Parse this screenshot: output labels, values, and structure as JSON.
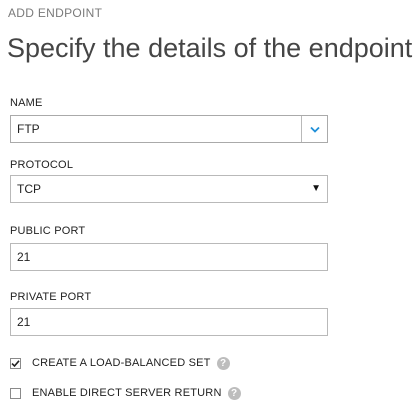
{
  "header": {
    "kicker": "ADD ENDPOINT",
    "title": "Specify the details of the endpoint"
  },
  "form": {
    "name": {
      "label": "NAME",
      "value": "FTP"
    },
    "protocol": {
      "label": "PROTOCOL",
      "value": "TCP",
      "arrow": "▼"
    },
    "public_port": {
      "label": "PUBLIC PORT",
      "value": "21"
    },
    "private_port": {
      "label": "PRIVATE PORT",
      "value": "21"
    },
    "load_balanced": {
      "label": "CREATE A LOAD-BALANCED SET",
      "checked": true,
      "help": "?"
    },
    "direct_server_return": {
      "label": "ENABLE DIRECT SERVER RETURN",
      "checked": false,
      "help": "?"
    }
  },
  "colors": {
    "accent": "#1f8fd8",
    "border": "#b9b9b9",
    "help_icon": "#bdbdbd"
  },
  "icons": {
    "combo_chevron": "chevron-down-icon",
    "select_arrow": "triangle-down-icon",
    "help": "help-icon",
    "check": "checkmark-icon"
  }
}
